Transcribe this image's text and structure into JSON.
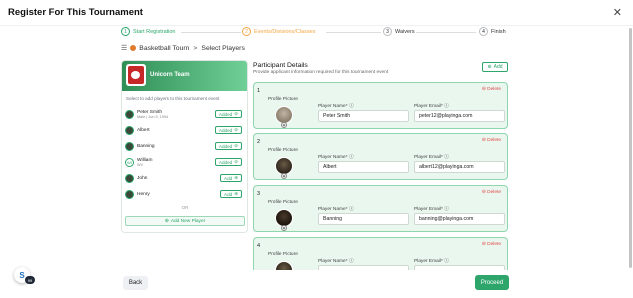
{
  "modal": {
    "title": "Register For This Tournament",
    "close_icon": "close-icon"
  },
  "stepper": {
    "steps": [
      {
        "num": "1",
        "label": "Start Registration",
        "color": "#2ea66b"
      },
      {
        "num": "2",
        "label": "Events/Divisions/Classes",
        "color": "#f3a545"
      },
      {
        "num": "3",
        "label": "Waivers",
        "color": "#333333"
      },
      {
        "num": "4",
        "label": "Finish",
        "color": "#333333"
      }
    ]
  },
  "breadcrumb": {
    "sport": "Basketball Tourn",
    "sep": ">",
    "current": "Select Players"
  },
  "team": {
    "name": "Unicorn Team",
    "description": "Select to add players to this tournament event",
    "players": [
      {
        "name": "Peter Smith",
        "sub": "Male | Jun 5, 1994",
        "avatar": "photo",
        "action": "Added"
      },
      {
        "name": "Albert",
        "sub": "",
        "avatar": "photo",
        "action": "Added"
      },
      {
        "name": "Banning",
        "sub": "",
        "avatar": "photo",
        "action": "Added"
      },
      {
        "name": "William",
        "sub": "WV",
        "avatar": "WI",
        "action": "Added"
      },
      {
        "name": "John",
        "sub": "",
        "avatar": "photo",
        "action": "Add"
      },
      {
        "name": "Henry",
        "sub": "",
        "avatar": "photo",
        "action": "Add"
      }
    ],
    "or_label": "OR",
    "add_new_player": "Add New Player"
  },
  "participants": {
    "title": "Participant Details",
    "subtitle": "Provide applicant information required for this tournament event",
    "add_label": "Add",
    "profile_picture_label": "Profile Picture",
    "player_name_label": "Player Name",
    "player_email_label": "Player Email",
    "delete_label": "Delete",
    "cards": [
      {
        "num": "1",
        "name": "Peter Smith",
        "email": "peter12@playinga.com"
      },
      {
        "num": "2",
        "name": "Albert",
        "email": "albert12@playinga.com"
      },
      {
        "num": "3",
        "name": "Banning",
        "email": "banning@playinga.com"
      },
      {
        "num": "4",
        "name": "",
        "email": ""
      }
    ]
  },
  "footer": {
    "back": "Back",
    "proceed": "Proceed",
    "chat_badge": "99"
  },
  "colors": {
    "accent": "#2ea66b",
    "warning": "#f3a545",
    "danger": "#e04848"
  }
}
